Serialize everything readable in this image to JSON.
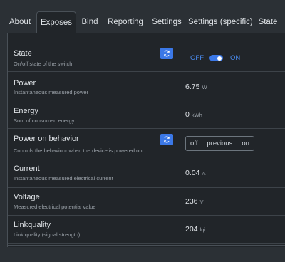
{
  "tabs": [
    "About",
    "Exposes",
    "Bind",
    "Reporting",
    "Settings",
    "Settings (specific)",
    "State"
  ],
  "active_tab": "Exposes",
  "rows": {
    "state": {
      "name": "State",
      "desc": "On/off state of the switch",
      "off_label": "OFF",
      "on_label": "ON"
    },
    "power": {
      "name": "Power",
      "desc": "Instantaneous measured power",
      "value": "6.75",
      "unit": "W"
    },
    "energy": {
      "name": "Energy",
      "desc": "Sum of consumed energy",
      "value": "0",
      "unit": "kWh"
    },
    "power_on": {
      "name": "Power on behavior",
      "desc": "Controls the behaviour when the device is powered on",
      "options": [
        "off",
        "previous",
        "on"
      ]
    },
    "current": {
      "name": "Current",
      "desc": "Instantaneous measured electrical current",
      "value": "0.04",
      "unit": "A"
    },
    "voltage": {
      "name": "Voltage",
      "desc": "Measured electrical potential value",
      "value": "236",
      "unit": "V"
    },
    "linkquality": {
      "name": "Linkquality",
      "desc": "Link quality (signal strength)",
      "value": "204",
      "unit": "lqi"
    }
  },
  "colors": {
    "accent": "#3b78e7",
    "background": "#212529",
    "header": "#2b3035"
  }
}
